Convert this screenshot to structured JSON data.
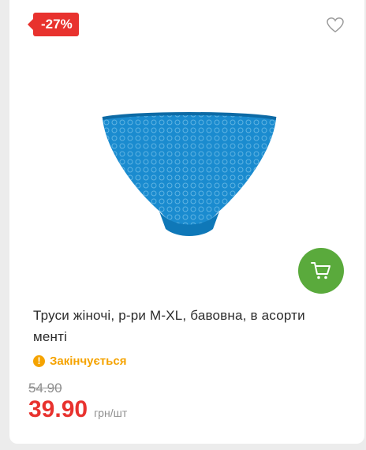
{
  "badge": {
    "discount": "-27%",
    "color": "#e8322e"
  },
  "icons": {
    "wishlist": "heart-outline-icon",
    "cart": "shopping-cart-icon",
    "status": "exclamation-icon"
  },
  "product": {
    "title": "Труси жіночі, р-ри M-XL, бавовна, в асорти менті",
    "status": "Закінчується",
    "old_price": "54.90",
    "price": "39.90",
    "unit": "грн/шт"
  },
  "colors": {
    "accent": "#e8322e",
    "cart": "#5aaa3c",
    "status": "#f5a300"
  }
}
